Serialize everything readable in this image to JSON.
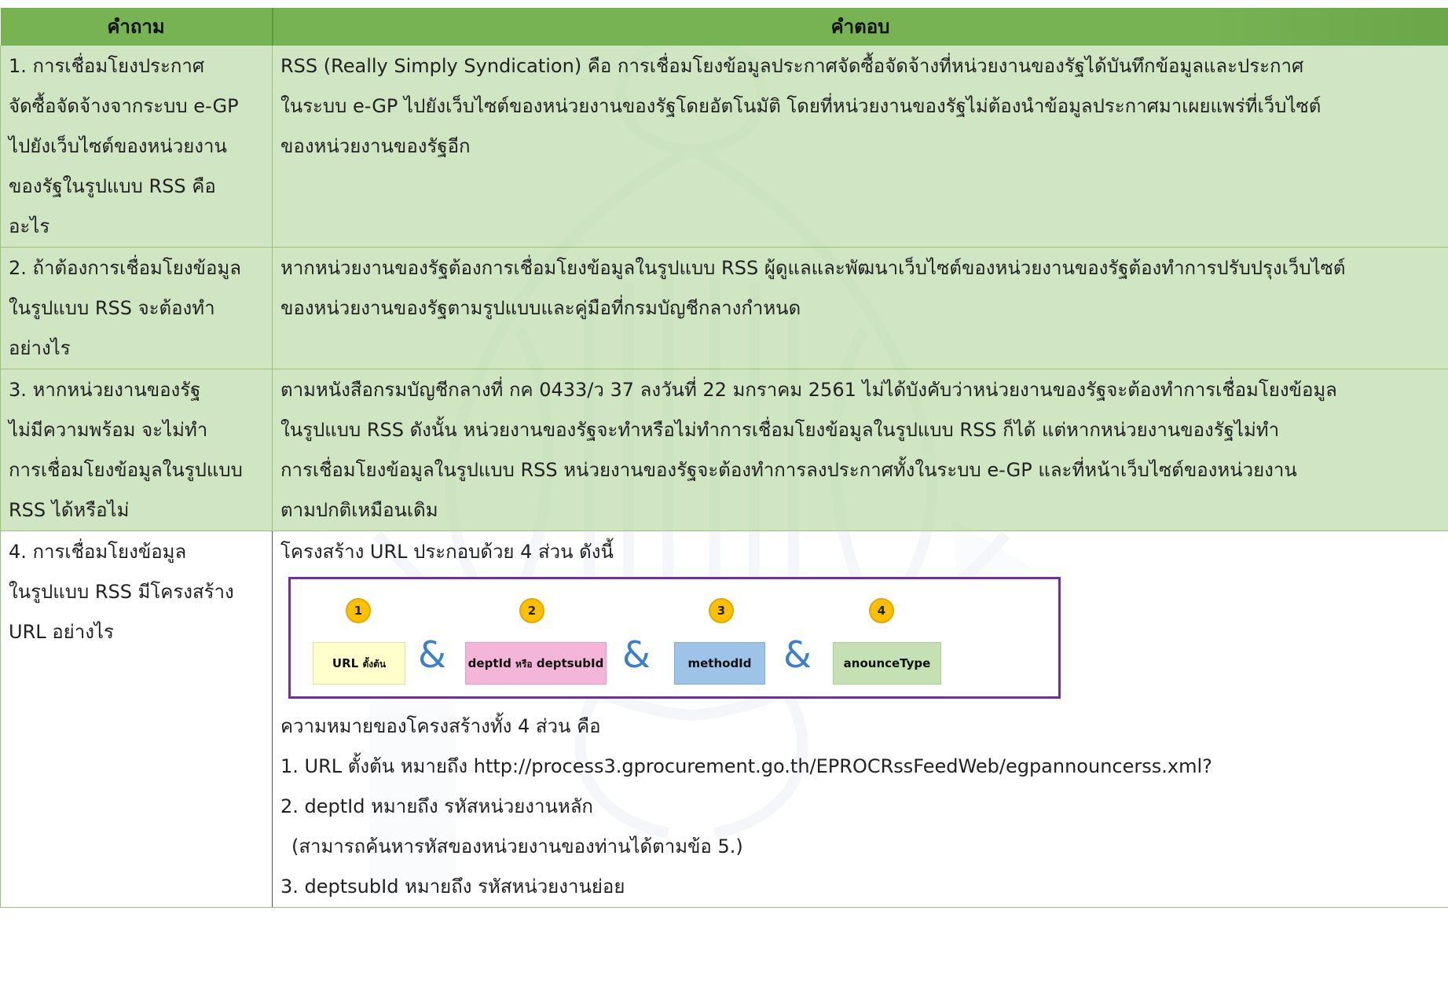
{
  "header": {
    "question_label": "คำถาม",
    "answer_label": "คำตอบ"
  },
  "rows": [
    {
      "q": [
        "1. การเชื่อมโยงประกาศ",
        "จัดซื้อจัดจ้างจากระบบ e-GP",
        "ไปยังเว็บไซต์ของหน่วยงาน",
        "ของรัฐในรูปแบบ RSS คือ",
        "อะไร"
      ],
      "a": [
        "RSS (Really Simply Syndication) คือ การเชื่อมโยงข้อมูลประกาศจัดซื้อจัดจ้างที่หน่วยงานของรัฐได้บันทึกข้อมูลและประกาศ",
        "ในระบบ e-GP ไปยังเว็บไซต์ของหน่วยงานของรัฐโดยอัตโนมัติ โดยที่หน่วยงานของรัฐไม่ต้องนำข้อมูลประกาศมาเผยแพร่ที่เว็บไซต์",
        "ของหน่วยงานของรัฐอีก"
      ]
    },
    {
      "q": [
        "2. ถ้าต้องการเชื่อมโยงข้อมูล",
        "ในรูปแบบ RSS จะต้องทำ",
        "อย่างไร"
      ],
      "a": [
        "หากหน่วยงานของรัฐต้องการเชื่อมโยงข้อมูลในรูปแบบ RSS ผู้ดูแลและพัฒนาเว็บไซต์ของหน่วยงานของรัฐต้องทำการปรับปรุงเว็บไซต์",
        "ของหน่วยงานของรัฐตามรูปแบบและคู่มือที่กรมบัญชีกลางกำหนด"
      ]
    },
    {
      "q": [
        "3. หากหน่วยงานของรัฐ",
        "ไม่มีความพร้อม จะไม่ทำ",
        "การเชื่อมโยงข้อมูลในรูปแบบ",
        "RSS ได้หรือไม่"
      ],
      "a": [
        "ตามหนังสือกรมบัญชีกลางที่ กค 0433/ว 37 ลงวันที่ 22 มกราคม 2561 ไม่ได้บังคับว่าหน่วยงานของรัฐจะต้องทำการเชื่อมโยงข้อมูล",
        "ในรูปแบบ RSS ดังนั้น หน่วยงานของรัฐจะทำหรือไม่ทำการเชื่อมโยงข้อมูลในรูปแบบ RSS ก็ได้ แต่หากหน่วยงานของรัฐไม่ทำ",
        "การเชื่อมโยงข้อมูลในรูปแบบ RSS หน่วยงานของรัฐจะต้องทำการลงประกาศทั้งในระบบ e-GP และที่หน้าเว็บไซต์ของหน่วยงาน",
        "ตามปกติเหมือนเดิม"
      ]
    },
    {
      "q": [
        "4. การเชื่อมโยงข้อมูล",
        "ในรูปแบบ RSS มีโครงสร้าง",
        "URL อย่างไร"
      ],
      "intro": "โครงสร้าง URL ประกอบด้วย 4 ส่วน ดังนี้",
      "after": [
        "ความหมายของโครงสร้างทั้ง 4 ส่วน คือ",
        "1. URL ตั้งต้น หมายถึง http://process3.gprocurement.go.th/EPROCRssFeedWeb/egpannouncerss.xml?",
        "2. deptId หมายถึง รหัสหน่วยงานหลัก",
        "(สามารถค้นหารหัสของหน่วยงานของท่านได้ตามข้อ 5.)",
        "3. deptsubId หมายถึง รหัสหน่วยงานย่อย"
      ]
    }
  ],
  "diagram": {
    "numbers": [
      "1",
      "2",
      "3",
      "4"
    ],
    "amp": "&",
    "box1_main": "URL",
    "box1_small": "ตั้งต้น",
    "box2_main_a": "deptId",
    "box2_small": "หรือ",
    "box2_main_b": "deptsubId",
    "box3": "methodId",
    "box4": "anounceType",
    "colors": {
      "box1": "#ffffcc",
      "box2": "#f4b6d8",
      "box3": "#9dc3e6",
      "box4": "#c5e0b3",
      "frame": "#7030a0",
      "badge": "#ffc000",
      "amp": "#3b7fd0"
    }
  }
}
